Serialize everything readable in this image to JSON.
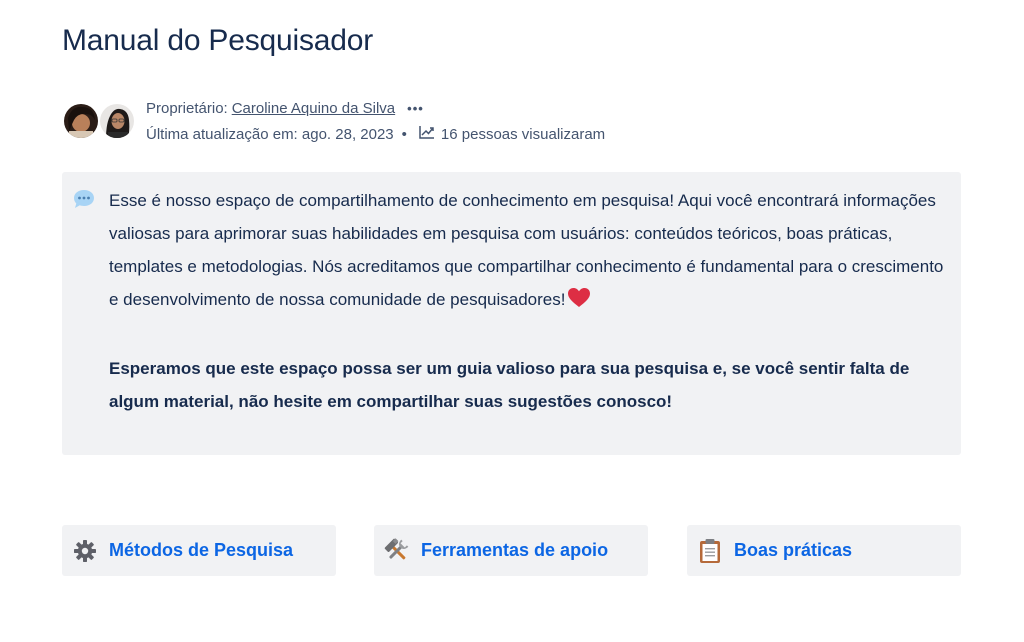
{
  "page": {
    "title": "Manual do Pesquisador"
  },
  "byline": {
    "owner_label": "Proprietário:",
    "owner_name": "Caroline Aquino da Silva",
    "more_label": "•••",
    "updated_label": "Última atualização em: ago. 28, 2023",
    "separator": "•",
    "views_label": "16 pessoas visualizaram",
    "views_icon": "chart-trend-icon"
  },
  "info_panel": {
    "icon": "speech-bubble-icon",
    "paragraph_1": "Esse é nosso espaço de compartilhamento de conhecimento em pesquisa!  Aqui você encontrará informações valiosas para aprimorar suas habilidades em pesquisa com usuários: conteúdos teóricos, boas práticas, templates e metodologias. Nós acreditamos que compartilhar conhecimento é fundamental para o crescimento e desenvolvimento de nossa comunidade de pesquisadores!",
    "paragraph_1_emoji": "heart-icon",
    "paragraph_2": "Esperamos que este espaço possa ser um guia valioso para sua pesquisa e, se você sentir falta de algum material, não hesite em compartilhar suas sugestões conosco!"
  },
  "cards": [
    {
      "label": "Métodos de Pesquisa",
      "icon": "gear-icon"
    },
    {
      "label": "Ferramentas de apoio",
      "icon": "hammer-wrench-icon"
    },
    {
      "label": "Boas práticas",
      "icon": "clipboard-icon"
    }
  ],
  "colors": {
    "title": "#172b4d",
    "meta_text": "#44546f",
    "panel_bg": "#f1f2f4",
    "link_blue": "#0c66e4",
    "heart_red": "#dd2e44"
  }
}
